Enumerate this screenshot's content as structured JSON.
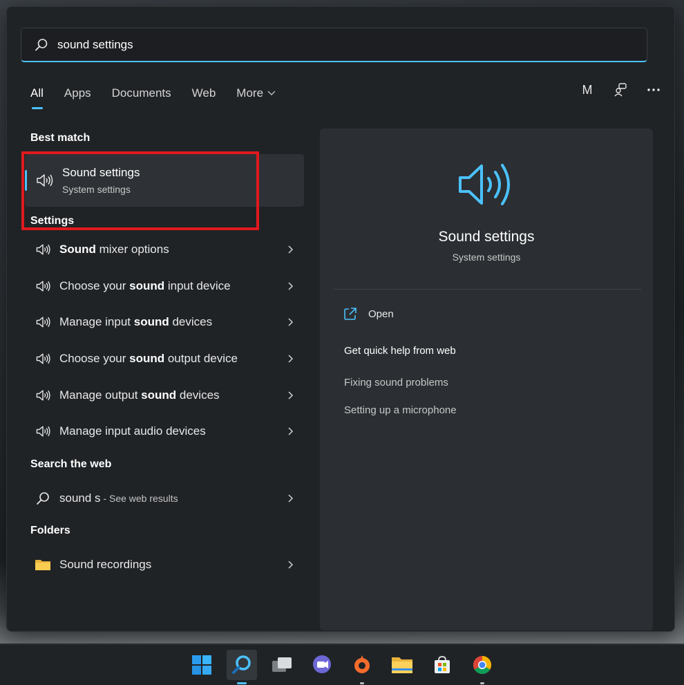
{
  "search": {
    "value": "sound settings",
    "icon": "search-icon"
  },
  "tabs": [
    {
      "label": "All",
      "active": true
    },
    {
      "label": "Apps"
    },
    {
      "label": "Documents"
    },
    {
      "label": "Web"
    },
    {
      "label": "More"
    }
  ],
  "top_right": {
    "avatar_letter": "M"
  },
  "best_match": {
    "heading": "Best match",
    "title": "Sound settings",
    "subtitle": "System settings"
  },
  "settings": {
    "heading": "Settings",
    "items": [
      {
        "pre": "",
        "bold": "Sound",
        "post": " mixer options"
      },
      {
        "pre": "Choose your ",
        "bold": "sound",
        "post": " input device"
      },
      {
        "pre": "Manage input ",
        "bold": "sound",
        "post": " devices"
      },
      {
        "pre": "Choose your ",
        "bold": "sound",
        "post": " output device"
      },
      {
        "pre": "Manage output ",
        "bold": "sound",
        "post": " devices"
      },
      {
        "pre": "Manage input audio devices",
        "bold": "",
        "post": ""
      }
    ]
  },
  "web": {
    "heading": "Search the web",
    "query": "sound s",
    "suffix": " - See web results"
  },
  "folders": {
    "heading": "Folders",
    "item": "Sound recordings"
  },
  "preview": {
    "title": "Sound settings",
    "subtitle": "System settings",
    "open_label": "Open",
    "help_heading": "Get quick help from web",
    "links": [
      "Fixing sound problems",
      "Setting up a microphone"
    ]
  },
  "colors": {
    "accent": "#4cc2ff",
    "highlight": "#e0191e",
    "panel": "#202326"
  },
  "taskbar": {
    "icons": [
      "windows-start-icon",
      "search-icon",
      "task-view-icon",
      "teams-chat-icon",
      "origin-icon",
      "file-explorer-icon",
      "microsoft-store-icon",
      "chrome-icon"
    ]
  }
}
